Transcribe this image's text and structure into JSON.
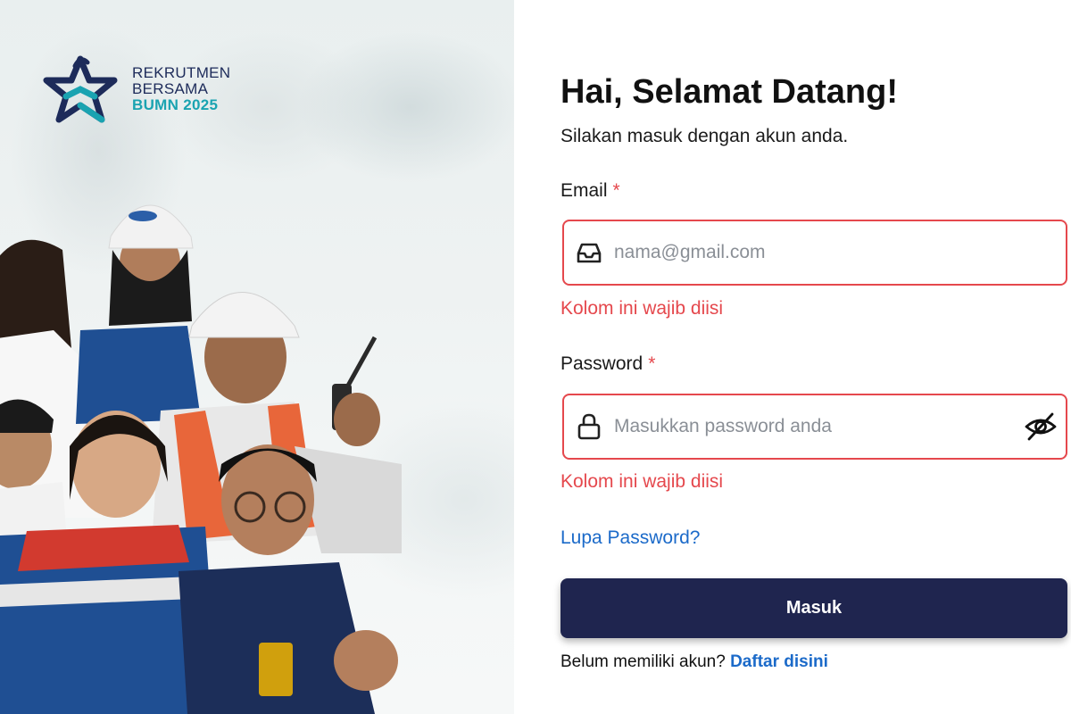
{
  "brand": {
    "line1": "REKRUTMEN",
    "line2": "BERSAMA",
    "line3": "BUMN 2025",
    "colors": {
      "navy": "#1d2b5a",
      "teal": "#1aa3b1"
    }
  },
  "form": {
    "title": "Hai, Selamat Datang!",
    "subtitle": "Silakan masuk dengan akun anda.",
    "email": {
      "label": "Email",
      "required_mark": "*",
      "placeholder": "nama@gmail.com",
      "value": "",
      "icon": "inbox-icon",
      "error": "Kolom ini wajib diisi"
    },
    "password": {
      "label": "Password",
      "required_mark": "*",
      "placeholder": "Masukkan password anda",
      "value": "",
      "icon": "lock-icon",
      "toggle_icon": "eye-off-icon",
      "error": "Kolom ini wajib diisi"
    },
    "forgot_link": "Lupa Password?",
    "submit_label": "Masuk",
    "signup_prompt": "Belum memiliki akun?",
    "signup_link": "Daftar disini"
  },
  "colors": {
    "error": "#e5484d",
    "link": "#1b6ac9",
    "button": "#1f254f"
  }
}
